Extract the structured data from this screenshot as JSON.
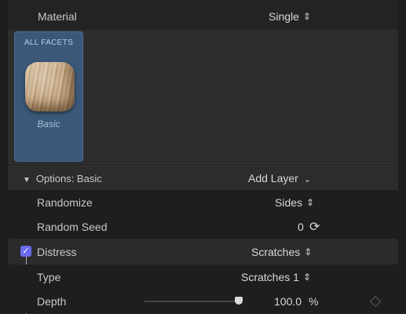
{
  "header": {
    "label": "Material",
    "value": "Single",
    "stepper_icon": "up-down-stepper"
  },
  "facet": {
    "tab_label": "ALL FACETS",
    "caption": "Basic"
  },
  "options": {
    "label": "Options: Basic",
    "add_layer": "Add Layer",
    "disclosure_icon": "triangle-down",
    "menu_icon": "chevron-down"
  },
  "rows": {
    "randomize": {
      "label": "Randomize",
      "value": "Sides"
    },
    "random_seed": {
      "label": "Random Seed",
      "value": "0",
      "icon": "refresh-arrows"
    },
    "distress": {
      "label": "Distress",
      "value": "Scratches",
      "checked": true
    },
    "type": {
      "label": "Type",
      "value": "Scratches 1"
    },
    "depth": {
      "label": "Depth",
      "value": "100.0",
      "unit": "%",
      "level": 1.0
    }
  },
  "colors": {
    "background": "#1e1e1e",
    "facet_card": "#3b5879",
    "checkbox_accent": "#6a6cf0"
  }
}
